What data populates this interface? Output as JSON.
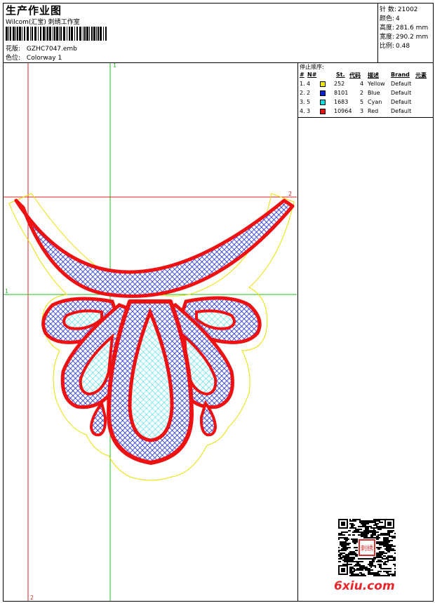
{
  "header": {
    "title": "生产作业图",
    "studio": "Wilcom(汇宝) 刺绣工作室",
    "design_label": "花版:",
    "design_value": "GZHC7047.emb",
    "colorway_label": "色位:",
    "colorway_value": "Colorway 1"
  },
  "stats": [
    {
      "label": "针 数:",
      "value": "21002"
    },
    {
      "label": "颜色:",
      "value": "4"
    },
    {
      "label": "高度:",
      "value": "281.6 mm"
    },
    {
      "label": "宽度:",
      "value": "290.2 mm"
    },
    {
      "label": "比例:",
      "value": "0.48"
    }
  ],
  "stop_sequence": {
    "title": "停止顺序:",
    "columns": [
      "#",
      "N#",
      "St.",
      "代码",
      "描述",
      "Brand",
      "元素"
    ],
    "rows": [
      {
        "num": "1.",
        "n": "4",
        "color": "#f5e800",
        "st": "252",
        "code": "4",
        "desc": "Yellow",
        "brand": "Default"
      },
      {
        "num": "2.",
        "n": "2",
        "color": "#1020d0",
        "st": "8101",
        "code": "2",
        "desc": "Blue",
        "brand": "Default"
      },
      {
        "num": "3.",
        "n": "5",
        "color": "#00e0e0",
        "st": "1683",
        "code": "5",
        "desc": "Cyan",
        "brand": "Default"
      },
      {
        "num": "4.",
        "n": "3",
        "color": "#ee1111",
        "st": "10964",
        "code": "3",
        "desc": "Red",
        "brand": "Default"
      }
    ]
  },
  "guides": {
    "v_green_label": "1",
    "h_green_label": "1",
    "h_red_label": "2",
    "v_red_label": "2"
  },
  "watermark": "6xiu.com",
  "seal_text": "刺绣",
  "colors": {
    "red": "#ee1111",
    "blue": "#1a2ad8",
    "cyan": "#20d8e0",
    "yellow": "#e8e000",
    "guide_green": "#22bb22",
    "guide_red": "#dd2222"
  }
}
